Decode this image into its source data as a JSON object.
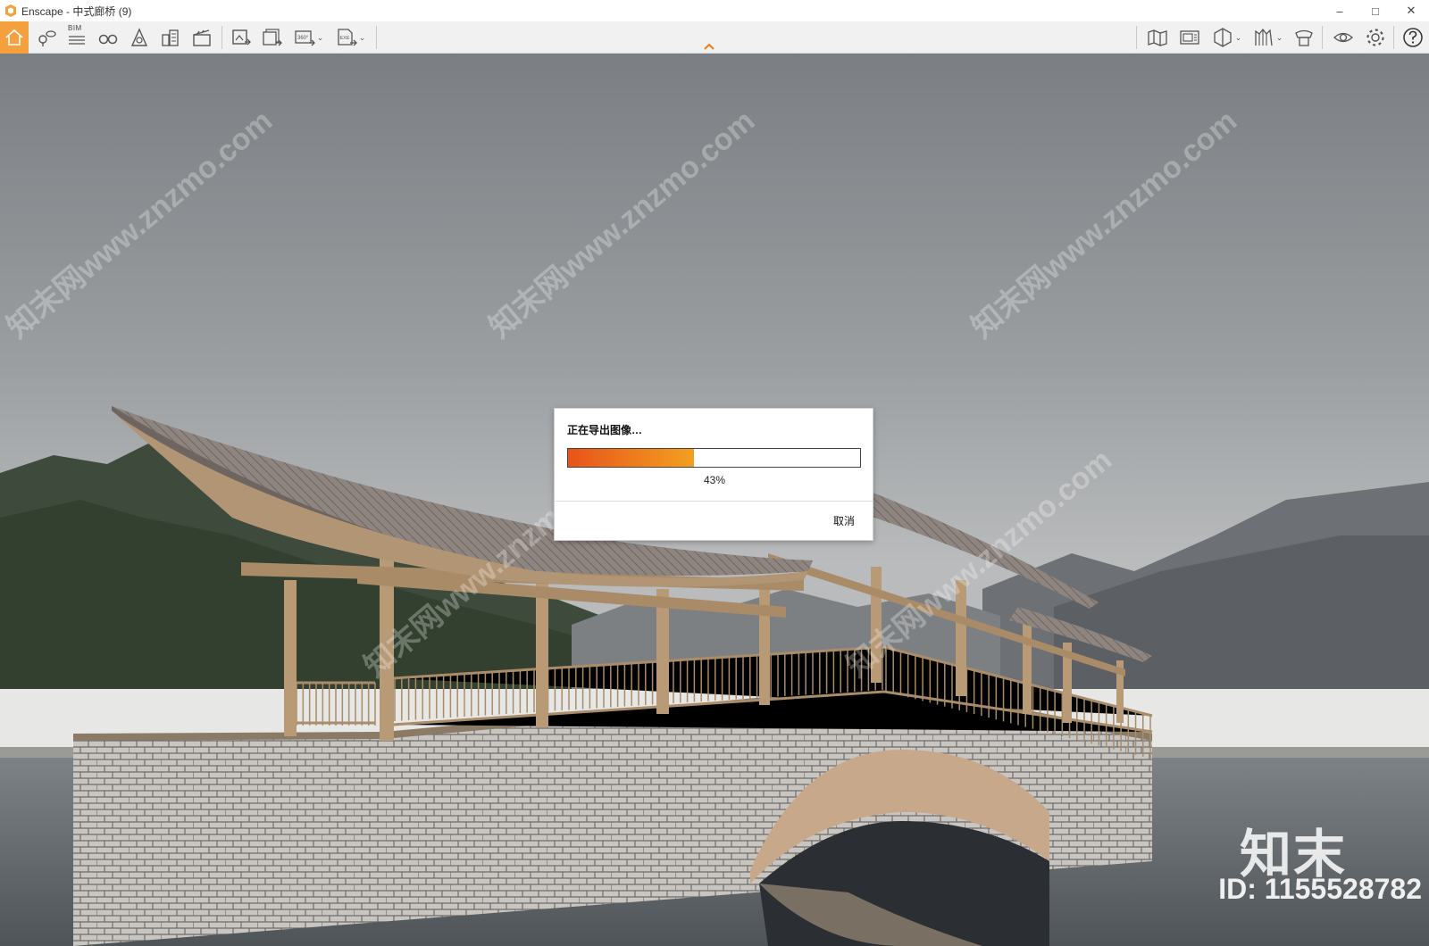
{
  "window": {
    "title": "Enscape - 中式廊桥 (9)",
    "minimize": "–",
    "maximize": "□",
    "close": "✕"
  },
  "toolbar": {
    "bim_label": "BIM",
    "icons_left": [
      "home-icon",
      "view-manager-icon",
      "bim-icon",
      "binoculars-icon",
      "atmosphere-icon",
      "buildings-icon",
      "clapperboard-icon",
      "render-image-icon",
      "batch-render-icon",
      "panorama-360-icon",
      "exe-export-icon"
    ],
    "icons_right": [
      "map-icon",
      "video-icon",
      "cube-icon",
      "asset-library-icon",
      "collaboration-icon",
      "visibility-icon",
      "settings-icon",
      "help-icon"
    ],
    "panorama_label": "360°",
    "exe_label": "EXE",
    "accent_color": "#f5a03f"
  },
  "watermark": {
    "text": "知末网www.znzmo.com",
    "brand": "知末",
    "id_text": "ID: 1155528782"
  },
  "dialog": {
    "title": "正在导出图像…",
    "progress_percent": 43,
    "progress_text": "43%",
    "cancel_label": "取消",
    "bar_colors": [
      "#e8541a",
      "#f2a020"
    ]
  }
}
